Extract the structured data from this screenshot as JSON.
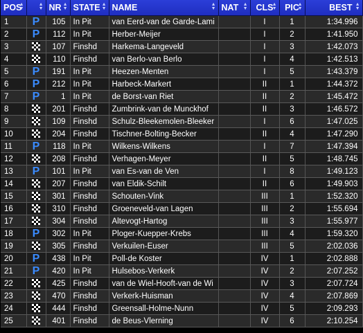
{
  "headers": {
    "pos": "POS",
    "nr": "NR",
    "state": "STATE",
    "name": "NAME",
    "nat": "NAT",
    "cls": "CLS",
    "pic": "PIC",
    "best": "BEST"
  },
  "icons": {
    "pit": "P",
    "finished": "checkered-flag"
  },
  "colors": {
    "header_bg": "#2536d0",
    "pit_icon": "#3a8bff"
  },
  "rows": [
    {
      "pos": "1",
      "icon": "pit",
      "nr": "105",
      "state": "In Pit",
      "name": "van Eerd-van de Garde-Lami",
      "nat": "",
      "cls": "I",
      "pic": "1",
      "best": "1:34.996"
    },
    {
      "pos": "2",
      "icon": "pit",
      "nr": "112",
      "state": "In Pit",
      "name": "Herber-Meijer",
      "nat": "",
      "cls": "I",
      "pic": "2",
      "best": "1:41.950"
    },
    {
      "pos": "3",
      "icon": "finished",
      "nr": "107",
      "state": "Finshd",
      "name": "Harkema-Langeveld",
      "nat": "",
      "cls": "I",
      "pic": "3",
      "best": "1:42.073"
    },
    {
      "pos": "4",
      "icon": "finished",
      "nr": "110",
      "state": "Finshd",
      "name": "van Berlo-van Berlo",
      "nat": "",
      "cls": "I",
      "pic": "4",
      "best": "1:42.513"
    },
    {
      "pos": "5",
      "icon": "pit",
      "nr": "191",
      "state": "In Pit",
      "name": "Heezen-Menten",
      "nat": "",
      "cls": "I",
      "pic": "5",
      "best": "1:43.379"
    },
    {
      "pos": "6",
      "icon": "pit",
      "nr": "212",
      "state": "In Pit",
      "name": "Harbeck-Markert",
      "nat": "",
      "cls": "II",
      "pic": "1",
      "best": "1:44.372"
    },
    {
      "pos": "7",
      "icon": "pit",
      "nr": "1",
      "state": "In Pit",
      "name": "de Borst-van Riet",
      "nat": "",
      "cls": "II",
      "pic": "2",
      "best": "1:45.472"
    },
    {
      "pos": "8",
      "icon": "finished",
      "nr": "201",
      "state": "Finshd",
      "name": "Zumbrink-van de Munckhof",
      "nat": "",
      "cls": "II",
      "pic": "3",
      "best": "1:46.572"
    },
    {
      "pos": "9",
      "icon": "finished",
      "nr": "109",
      "state": "Finshd",
      "name": "Schulz-Bleekemolen-Bleeker",
      "nat": "",
      "cls": "I",
      "pic": "6",
      "best": "1:47.025"
    },
    {
      "pos": "10",
      "icon": "finished",
      "nr": "204",
      "state": "Finshd",
      "name": "Tischner-Bolting-Becker",
      "nat": "",
      "cls": "II",
      "pic": "4",
      "best": "1:47.290"
    },
    {
      "pos": "11",
      "icon": "pit",
      "nr": "118",
      "state": "In Pit",
      "name": "Wilkens-Wilkens",
      "nat": "",
      "cls": "I",
      "pic": "7",
      "best": "1:47.394"
    },
    {
      "pos": "12",
      "icon": "finished",
      "nr": "208",
      "state": "Finshd",
      "name": "Verhagen-Meyer",
      "nat": "",
      "cls": "II",
      "pic": "5",
      "best": "1:48.745"
    },
    {
      "pos": "13",
      "icon": "pit",
      "nr": "101",
      "state": "In Pit",
      "name": "van Es-van de Ven",
      "nat": "",
      "cls": "I",
      "pic": "8",
      "best": "1:49.123"
    },
    {
      "pos": "14",
      "icon": "finished",
      "nr": "207",
      "state": "Finshd",
      "name": "van Eldik-Schilt",
      "nat": "",
      "cls": "II",
      "pic": "6",
      "best": "1:49.903"
    },
    {
      "pos": "15",
      "icon": "finished",
      "nr": "301",
      "state": "Finshd",
      "name": "Schouten-Vink",
      "nat": "",
      "cls": "III",
      "pic": "1",
      "best": "1:52.320"
    },
    {
      "pos": "16",
      "icon": "finished",
      "nr": "310",
      "state": "Finshd",
      "name": "Groeneveld-van Lagen",
      "nat": "",
      "cls": "III",
      "pic": "2",
      "best": "1:55.694"
    },
    {
      "pos": "17",
      "icon": "finished",
      "nr": "304",
      "state": "Finshd",
      "name": "Altevogt-Hartog",
      "nat": "",
      "cls": "III",
      "pic": "3",
      "best": "1:55.977"
    },
    {
      "pos": "18",
      "icon": "pit",
      "nr": "302",
      "state": "In Pit",
      "name": "Ploger-Kuepper-Krebs",
      "nat": "",
      "cls": "III",
      "pic": "4",
      "best": "1:59.320"
    },
    {
      "pos": "19",
      "icon": "finished",
      "nr": "305",
      "state": "Finshd",
      "name": "Verkuilen-Euser",
      "nat": "",
      "cls": "III",
      "pic": "5",
      "best": "2:02.036"
    },
    {
      "pos": "20",
      "icon": "pit",
      "nr": "438",
      "state": "In Pit",
      "name": "Poll-de Koster",
      "nat": "",
      "cls": "IV",
      "pic": "1",
      "best": "2:02.888"
    },
    {
      "pos": "21",
      "icon": "pit",
      "nr": "420",
      "state": "In Pit",
      "name": "Hulsebos-Verkerk",
      "nat": "",
      "cls": "IV",
      "pic": "2",
      "best": "2:07.252"
    },
    {
      "pos": "22",
      "icon": "finished",
      "nr": "425",
      "state": "Finshd",
      "name": "van de Wiel-Hooft-van de Wi",
      "nat": "",
      "cls": "IV",
      "pic": "3",
      "best": "2:07.724"
    },
    {
      "pos": "23",
      "icon": "finished",
      "nr": "470",
      "state": "Finshd",
      "name": "Verkerk-Huisman",
      "nat": "",
      "cls": "IV",
      "pic": "4",
      "best": "2:07.869"
    },
    {
      "pos": "24",
      "icon": "finished",
      "nr": "444",
      "state": "Finshd",
      "name": "Greensall-Holme-Nunn",
      "nat": "",
      "cls": "IV",
      "pic": "5",
      "best": "2:09.293"
    },
    {
      "pos": "25",
      "icon": "finished",
      "nr": "401",
      "state": "Finshd",
      "name": "de Beus-Vlerning",
      "nat": "",
      "cls": "IV",
      "pic": "6",
      "best": "2:10.254"
    }
  ]
}
